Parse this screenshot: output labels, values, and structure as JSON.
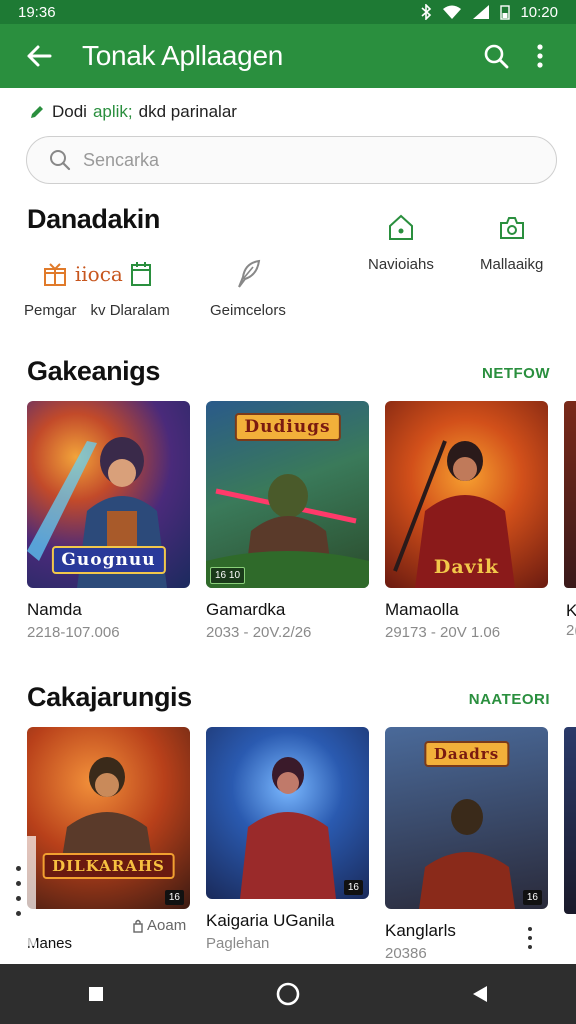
{
  "status_bar": {
    "time_left": "19:36",
    "time_right": "10:20"
  },
  "app_bar": {
    "title": "Tonak Apllaagen"
  },
  "subtitle": {
    "prefix": "Dodi",
    "highlight": "aplik;",
    "suffix": "dkd parinalar"
  },
  "search": {
    "placeholder": "Sencarka"
  },
  "categories": {
    "heading": "Danadakin",
    "items": [
      {
        "label": "Pemgar",
        "icon": "gift-icon"
      },
      {
        "label": "kv Dlaralam",
        "icon": "calendar-icon"
      },
      {
        "label": "Geimcelors",
        "icon": "leaf-icon"
      },
      {
        "label": "Navioiahs",
        "icon": "home-icon"
      },
      {
        "label": "Mallaaikg",
        "icon": "camera-icon"
      }
    ],
    "icon_mid_text": "iioca"
  },
  "section1": {
    "heading": "Gakeanigs",
    "link": "NETFOW",
    "cards": [
      {
        "name": "Namda",
        "meta": "2218-107.006",
        "logo": "Guognuu",
        "badge": ""
      },
      {
        "name": "Gamardka",
        "meta": "2033 - 20V.2/26",
        "logo": "Dudiugs",
        "badge": "16 10"
      },
      {
        "name": "Mamaolla",
        "meta": "29173 - 20V 1.06",
        "logo": "Davik",
        "badge": ""
      },
      {
        "name": "K",
        "meta": "2(",
        "logo": "",
        "badge": ""
      }
    ]
  },
  "section2": {
    "heading": "Cakajarungis",
    "link": "NAATEORI",
    "cards": [
      {
        "name": "Manes",
        "meta": "",
        "extra": "Aoam",
        "logo": "DILKARAHS",
        "badge": "16"
      },
      {
        "name": "Kaigaria UGanila",
        "meta": "Paglehan",
        "logo": "",
        "badge": "16"
      },
      {
        "name": "Kanglarls",
        "meta": "20386",
        "logo": "Daadrs",
        "badge": "16"
      }
    ]
  },
  "colors": {
    "primary": "#2a8f3e",
    "status": "#1e7a34",
    "nav": "#2e2e2e"
  }
}
